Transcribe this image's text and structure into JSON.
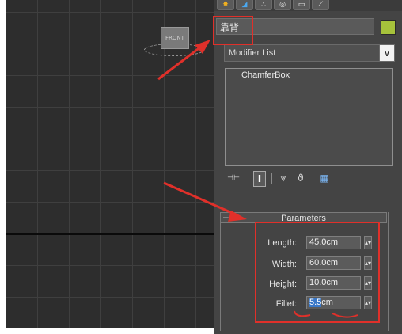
{
  "viewport": {
    "view_cube_label": "FRONT"
  },
  "command_panel": {
    "tabs": [
      {
        "icon": "sun-create-icon",
        "glyph": "✸",
        "color": "#f0b020"
      },
      {
        "icon": "modify-icon",
        "glyph": "◢",
        "color": "#4aa8f0"
      },
      {
        "icon": "hierarchy-icon",
        "glyph": "⛬",
        "color": "#e6e6e6"
      },
      {
        "icon": "motion-icon",
        "glyph": "◎",
        "color": "#e6e6e6"
      },
      {
        "icon": "display-icon",
        "glyph": "▭",
        "color": "#e6e6e6"
      },
      {
        "icon": "utilities-icon",
        "glyph": "⟋",
        "color": "#e6e6e6"
      }
    ],
    "object_name": "靠背",
    "object_color": "#a6c23b",
    "modifier_list_label": "Modifier List",
    "modifier_stack": [
      "ChamferBox"
    ],
    "stack_tools": [
      {
        "icon": "pin-stack-icon",
        "glyph": "⊣⊢"
      },
      {
        "icon": "show-end-result-icon",
        "glyph": "I"
      },
      {
        "icon": "make-unique-icon",
        "glyph": "⩔"
      },
      {
        "icon": "remove-modifier-icon",
        "glyph": "ϑ"
      },
      {
        "icon": "configure-sets-icon",
        "glyph": "▦"
      }
    ],
    "parameters": {
      "title": "Parameters",
      "toggle": "–",
      "fields": [
        {
          "label": "Length:",
          "value": "45.0cm"
        },
        {
          "label": "Width:",
          "value": "60.0cm"
        },
        {
          "label": "Height:",
          "value": "10.0cm"
        },
        {
          "label": "Fillet:",
          "value": "cm",
          "selected_prefix": "5.5"
        }
      ]
    }
  },
  "annotation_color": "#e0302a"
}
